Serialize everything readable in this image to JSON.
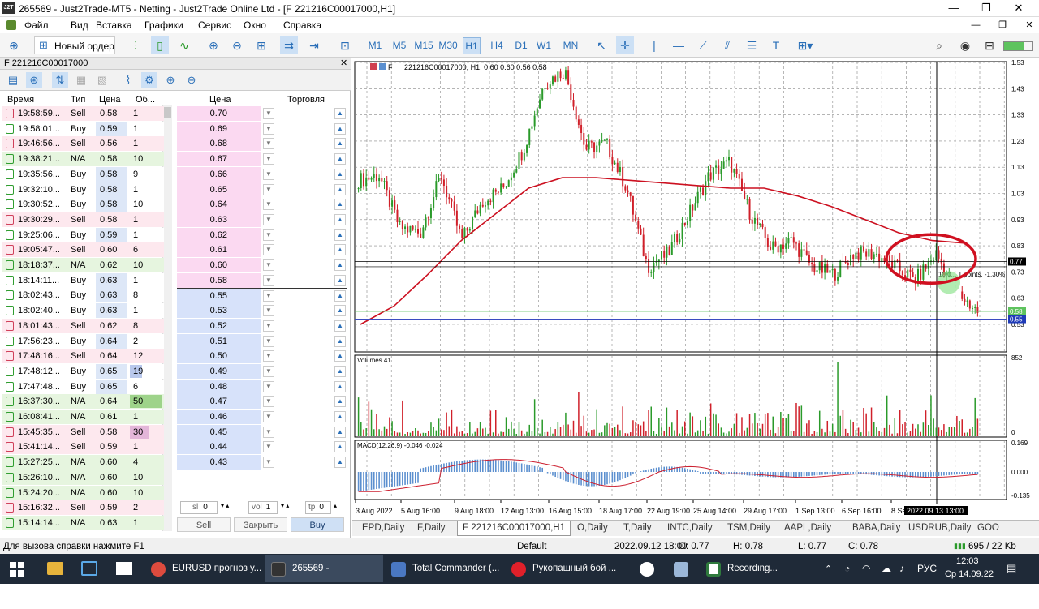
{
  "window": {
    "title": "265569 - Just2Trade-MT5 - Netting - Just2Trade Online Ltd - [F    221216C00017000,H1]",
    "logo_text": "J2T"
  },
  "menu": [
    "Файл",
    "Вид",
    "Вставка",
    "Графики",
    "Сервис",
    "Окно",
    "Справка"
  ],
  "toolbar": {
    "new_order": "Новый ордер",
    "timeframes": [
      "M1",
      "M5",
      "M15",
      "M30",
      "H1",
      "H4",
      "D1",
      "W1",
      "MN"
    ],
    "active_timeframe": "H1"
  },
  "market_panel": {
    "title": "F    221216C00017000",
    "columns": [
      "Время",
      "Тип",
      "Цена",
      "Об..."
    ],
    "dom_columns": [
      "Цена",
      "Торговля"
    ],
    "ticks": [
      {
        "time": "19:58:59...",
        "type": "Sell",
        "price": "0.58",
        "vol": "1"
      },
      {
        "time": "19:58:01...",
        "type": "Buy",
        "price": "0.59",
        "vol": "1"
      },
      {
        "time": "19:46:56...",
        "type": "Sell",
        "price": "0.56",
        "vol": "1"
      },
      {
        "time": "19:38:21...",
        "type": "N/A",
        "price": "0.58",
        "vol": "10"
      },
      {
        "time": "19:35:56...",
        "type": "Buy",
        "price": "0.58",
        "vol": "9"
      },
      {
        "time": "19:32:10...",
        "type": "Buy",
        "price": "0.58",
        "vol": "1"
      },
      {
        "time": "19:30:52...",
        "type": "Buy",
        "price": "0.58",
        "vol": "10"
      },
      {
        "time": "19:30:29...",
        "type": "Sell",
        "price": "0.58",
        "vol": "1"
      },
      {
        "time": "19:25:06...",
        "type": "Buy",
        "price": "0.59",
        "vol": "1"
      },
      {
        "time": "19:05:47...",
        "type": "Sell",
        "price": "0.60",
        "vol": "6"
      },
      {
        "time": "18:18:37...",
        "type": "N/A",
        "price": "0.62",
        "vol": "10"
      },
      {
        "time": "18:14:11...",
        "type": "Buy",
        "price": "0.63",
        "vol": "1"
      },
      {
        "time": "18:02:43...",
        "type": "Buy",
        "price": "0.63",
        "vol": "8"
      },
      {
        "time": "18:02:40...",
        "type": "Buy",
        "price": "0.63",
        "vol": "1"
      },
      {
        "time": "18:01:43...",
        "type": "Sell",
        "price": "0.62",
        "vol": "8"
      },
      {
        "time": "17:56:23...",
        "type": "Buy",
        "price": "0.64",
        "vol": "2"
      },
      {
        "time": "17:48:16...",
        "type": "Sell",
        "price": "0.64",
        "vol": "12"
      },
      {
        "time": "17:48:12...",
        "type": "Buy",
        "price": "0.65",
        "vol": "19"
      },
      {
        "time": "17:47:48...",
        "type": "Buy",
        "price": "0.65",
        "vol": "6"
      },
      {
        "time": "16:37:30...",
        "type": "N/A",
        "price": "0.64",
        "vol": "50"
      },
      {
        "time": "16:08:41...",
        "type": "N/A",
        "price": "0.61",
        "vol": "1"
      },
      {
        "time": "15:45:35...",
        "type": "Sell",
        "price": "0.58",
        "vol": "30"
      },
      {
        "time": "15:41:14...",
        "type": "Sell",
        "price": "0.59",
        "vol": "1"
      },
      {
        "time": "15:27:25...",
        "type": "N/A",
        "price": "0.60",
        "vol": "4"
      },
      {
        "time": "15:26:10...",
        "type": "N/A",
        "price": "0.60",
        "vol": "10"
      },
      {
        "time": "15:24:20...",
        "type": "N/A",
        "price": "0.60",
        "vol": "10"
      },
      {
        "time": "15:16:32...",
        "type": "Sell",
        "price": "0.59",
        "vol": "2"
      },
      {
        "time": "15:14:14...",
        "type": "N/A",
        "price": "0.63",
        "vol": "1"
      }
    ],
    "dom_prices": [
      "0.70",
      "0.69",
      "0.68",
      "0.67",
      "0.66",
      "0.65",
      "0.64",
      "0.63",
      "0.62",
      "0.61",
      "0.60",
      "0.58",
      "0.55",
      "0.53",
      "0.52",
      "0.51",
      "0.50",
      "0.49",
      "0.48",
      "0.47",
      "0.46",
      "0.45",
      "0.44",
      "0.43"
    ],
    "sl_label": "sl",
    "sl_value": "0",
    "vol_label": "vol",
    "vol_value": "1",
    "tp_label": "tp",
    "tp_value": "0",
    "sell_label": "Sell",
    "close_label": "Закрыть",
    "buy_label": "Buy"
  },
  "chart": {
    "header": "221216C00017000, H1:  0.60 0.60 0.56 0.58",
    "symbol_short": "F",
    "price_ticks": [
      "1.53",
      "1.43",
      "1.33",
      "1.23",
      "1.13",
      "1.03",
      "0.93",
      "0.83",
      "0.73",
      "0.63",
      "0.53"
    ],
    "current_price_labels": [
      "0.77",
      "0.58",
      "0.55"
    ],
    "volumes_label": "Volumes 41",
    "volume_ticks": [
      "852",
      "0"
    ],
    "macd_label": "MACD(12,26,9) -0.046 -0.024",
    "macd_ticks": [
      "0.169",
      "0.000",
      "-0.135"
    ],
    "time_labels": [
      "3 Aug 2022",
      "5 Aug 16:00",
      "9 Aug 18:00",
      "12 Aug 13:00",
      "16 Aug 15:00",
      "18 Aug 17:00",
      "22 Aug 19:00",
      "25 Aug 14:00",
      "29 Aug 17:00",
      "1 Sep 13:00",
      "6 Sep 16:00",
      "8 Sep"
    ],
    "cursor_time": "2022.09.13 13:00",
    "cursor_info": "10.0... 1 points, -1.30%",
    "colors": {
      "bull": "#2a9a2a",
      "bear": "#d0202a",
      "ma": "#cc1020",
      "macd": "#5b8fcf",
      "signal": "#cc2030",
      "circle": "#d01020"
    }
  },
  "chart_tabs": [
    "EPD,Daily",
    "F,Daily",
    "F    221216C00017000,H1",
    "O,Daily",
    "T,Daily",
    "INTC,Daily",
    "TSM,Daily",
    "AAPL,Daily",
    "BABA,Daily",
    "USDRUB,Daily",
    "GOO"
  ],
  "active_chart_tab": "F    221216C00017000,H1",
  "status": {
    "help": "Для вызова справки нажмите F1",
    "profile": "Default",
    "datetime": "2022.09.12 18:00",
    "open": "O: 0.77",
    "high": "H: 0.78",
    "low": "L: 0.77",
    "close": "C: 0.78",
    "traffic": "695 / 22 Kb"
  },
  "taskbar": {
    "items": [
      "EURUSD прогноз у...",
      "265569 - Just2Trade...",
      "Total Commander (...",
      "Рукопашный бой ...",
      "",
      "Recording..."
    ],
    "lang": "РУС",
    "time": "12:03",
    "date": "Ср 14.09.22"
  }
}
